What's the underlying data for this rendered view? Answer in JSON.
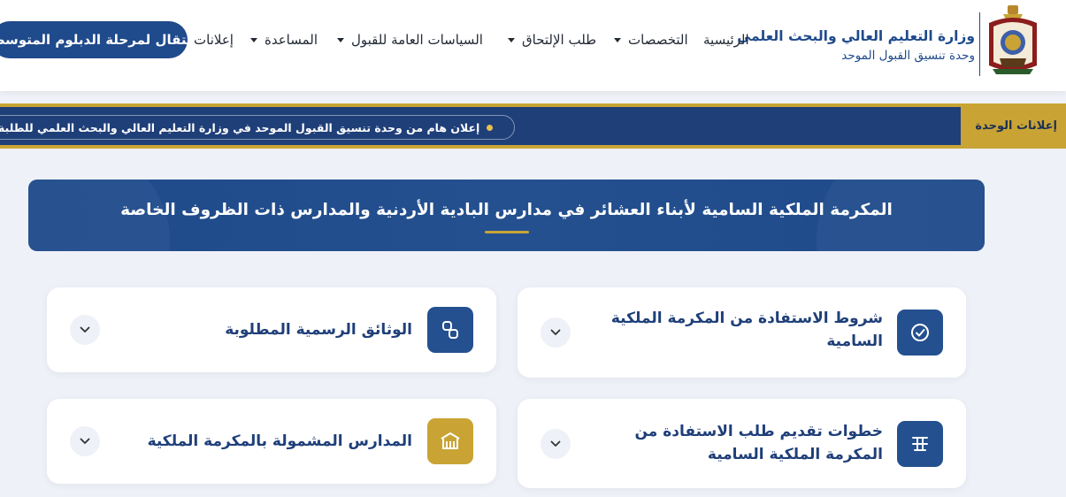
{
  "header": {
    "ministry_name": "وزارة التعليم العالي والبحث العلمي",
    "unit_name": "وحدة تنسيق القبول الموحد",
    "nav": [
      {
        "label": "الرئيسية",
        "dropdown": false
      },
      {
        "label": "التخصصات",
        "dropdown": true
      },
      {
        "label": "طلب الإلتحاق",
        "dropdown": true
      },
      {
        "label": "السياسات العامة للقبول",
        "dropdown": true
      },
      {
        "label": "المساعدة",
        "dropdown": true
      },
      {
        "label": "إعلانات",
        "dropdown": false
      }
    ],
    "cta_label": "الانتقال لمرحلة الدبلوم المتوسط"
  },
  "ticker": {
    "label": "إعلانات الوحدة",
    "text": "إعلان هام من وحدة تنسيق القبول الموحد في وزارة التعليم العالي والبحث العلمي للطلبة ذوي الإعاقة"
  },
  "banner": {
    "title": "المكرمة الملكية السامية لأبناء العشائر في مدارس البادية الأردنية والمدارس ذات الظروف الخاصة"
  },
  "cards": [
    {
      "title": "شروط الاستفادة من المكرمة الملكية السامية",
      "icon": "check-circle-icon",
      "color": "blue"
    },
    {
      "title": "الوثائق الرسمية المطلوبة",
      "icon": "link-icon",
      "color": "blue"
    },
    {
      "title": "خطوات تقديم طلب الاستفادة من المكرمة الملكية السامية",
      "icon": "steps-icon",
      "color": "blue"
    },
    {
      "title": "المدارس المشمولة بالمكرمة الملكية",
      "icon": "school-icon",
      "color": "gold"
    }
  ],
  "colors": {
    "primary": "#1f4a8b",
    "gold": "#c9a435",
    "background": "#eef1f7"
  }
}
